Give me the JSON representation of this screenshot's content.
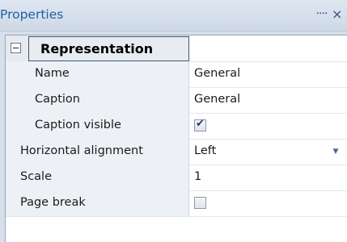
{
  "panel": {
    "title": "Properties",
    "pin_glyph": "᠁",
    "close_glyph": "×"
  },
  "grid": {
    "category": {
      "label": "Representation",
      "expanded": true
    },
    "rows": [
      {
        "label": "Name",
        "value": "General",
        "type": "text"
      },
      {
        "label": "Caption",
        "value": "General",
        "type": "text"
      },
      {
        "label": "Caption visible",
        "type": "checkbox",
        "checked": true
      },
      {
        "label": "Horizontal alignment",
        "value": "Left",
        "type": "dropdown"
      },
      {
        "label": "Scale",
        "value": "1",
        "type": "text"
      },
      {
        "label": "Page break",
        "type": "checkbox",
        "checked": false
      }
    ],
    "check_glyph": "✔",
    "dropdown_glyph": "▼"
  }
}
